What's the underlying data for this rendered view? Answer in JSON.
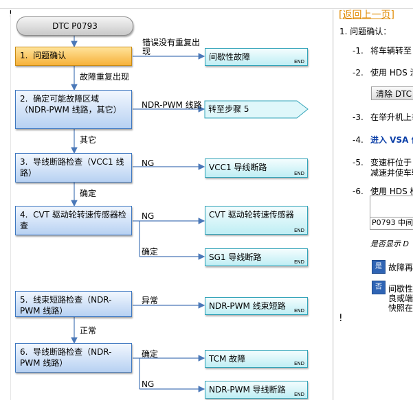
{
  "page": {
    "exclaim_top": "!",
    "exclaim_bottom": "!"
  },
  "flow": {
    "start": "DTC P0793",
    "steps": [
      {
        "num": "1.",
        "text": "问题确认"
      },
      {
        "num": "2.",
        "text": "确定可能故障区域（NDR-PWM 线路，其它）"
      },
      {
        "num": "3.",
        "text": "导线断路检查（VCC1 线路）"
      },
      {
        "num": "4.",
        "text": "CVT 驱动轮转速传感器检查"
      },
      {
        "num": "5.",
        "text": "线束短路检查（NDR-PWM 线路）"
      },
      {
        "num": "6.",
        "text": "导线断路检查（NDR-PWM 线路）"
      }
    ],
    "results": {
      "r1": "间歇性故障",
      "r2": "转至步骤 5",
      "r3": "VCC1 导线断路",
      "r4": "CVT 驱动轮转速传感器",
      "r5": "SG1 导线断路",
      "r6": "NDR-PWM 线束短路",
      "r7": "TCM 故障",
      "r8": "NDR-PWM 导线断路",
      "end_label": "END"
    },
    "labels": {
      "no_repeat": "错误没有重复出现",
      "repeat": "故障重复出现",
      "ndr_line": "NDR-PWM 线路",
      "other": "其它",
      "ng": "NG",
      "ok": "确定",
      "abnormal": "异常",
      "normal": "正常"
    }
  },
  "right": {
    "back_open": "[",
    "back_link": "返回上一页",
    "back_close": "]",
    "title": "1.  问题确认：",
    "items": [
      {
        "num": "-1.",
        "text": "将车辆转至"
      },
      {
        "num": "-2.",
        "text": "使用 HDS 清"
      },
      {
        "num": "-3.",
        "text": "在举升机上举"
      },
      {
        "num": "-4.",
        "text": "进入 VSA 倍"
      },
      {
        "num": "-5.",
        "text": "变速杆位于",
        "text2": "减速并使车辆"
      },
      {
        "num": "-6.",
        "text": "使用 HDS 检"
      }
    ],
    "clear_button": "清除 DTC",
    "dtc_row": "P0793 中间",
    "question": "是否显示 D",
    "yes_icon": "是",
    "no_icon": "否",
    "yes_text": "故障再",
    "no_text1": "间歇性",
    "no_text2": "良或端",
    "no_text3": "快照在"
  }
}
